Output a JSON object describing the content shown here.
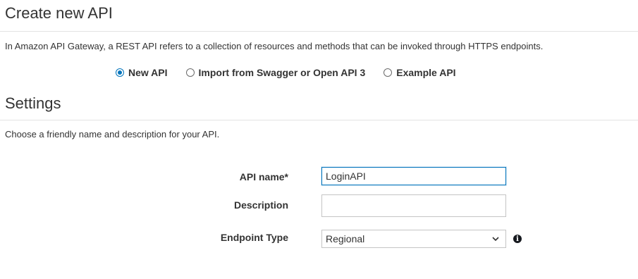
{
  "header": {
    "title": "Create new API"
  },
  "intro": "In Amazon API Gateway, a REST API refers to a collection of resources and methods that can be invoked through HTTPS endpoints.",
  "api_type": {
    "options": [
      {
        "label": "New API",
        "selected": true
      },
      {
        "label": "Import from Swagger or Open API 3",
        "selected": false
      },
      {
        "label": "Example API",
        "selected": false
      }
    ]
  },
  "settings": {
    "title": "Settings",
    "description": "Choose a friendly name and description for your API.",
    "fields": {
      "api_name": {
        "label": "API name*",
        "value": "LoginAPI"
      },
      "description": {
        "label": "Description",
        "value": ""
      },
      "endpoint_type": {
        "label": "Endpoint Type",
        "value": "Regional"
      }
    },
    "info_icon": "info-icon"
  },
  "colors": {
    "accent": "#0073bb",
    "text": "#333333",
    "rule": "#e3e3e3"
  }
}
